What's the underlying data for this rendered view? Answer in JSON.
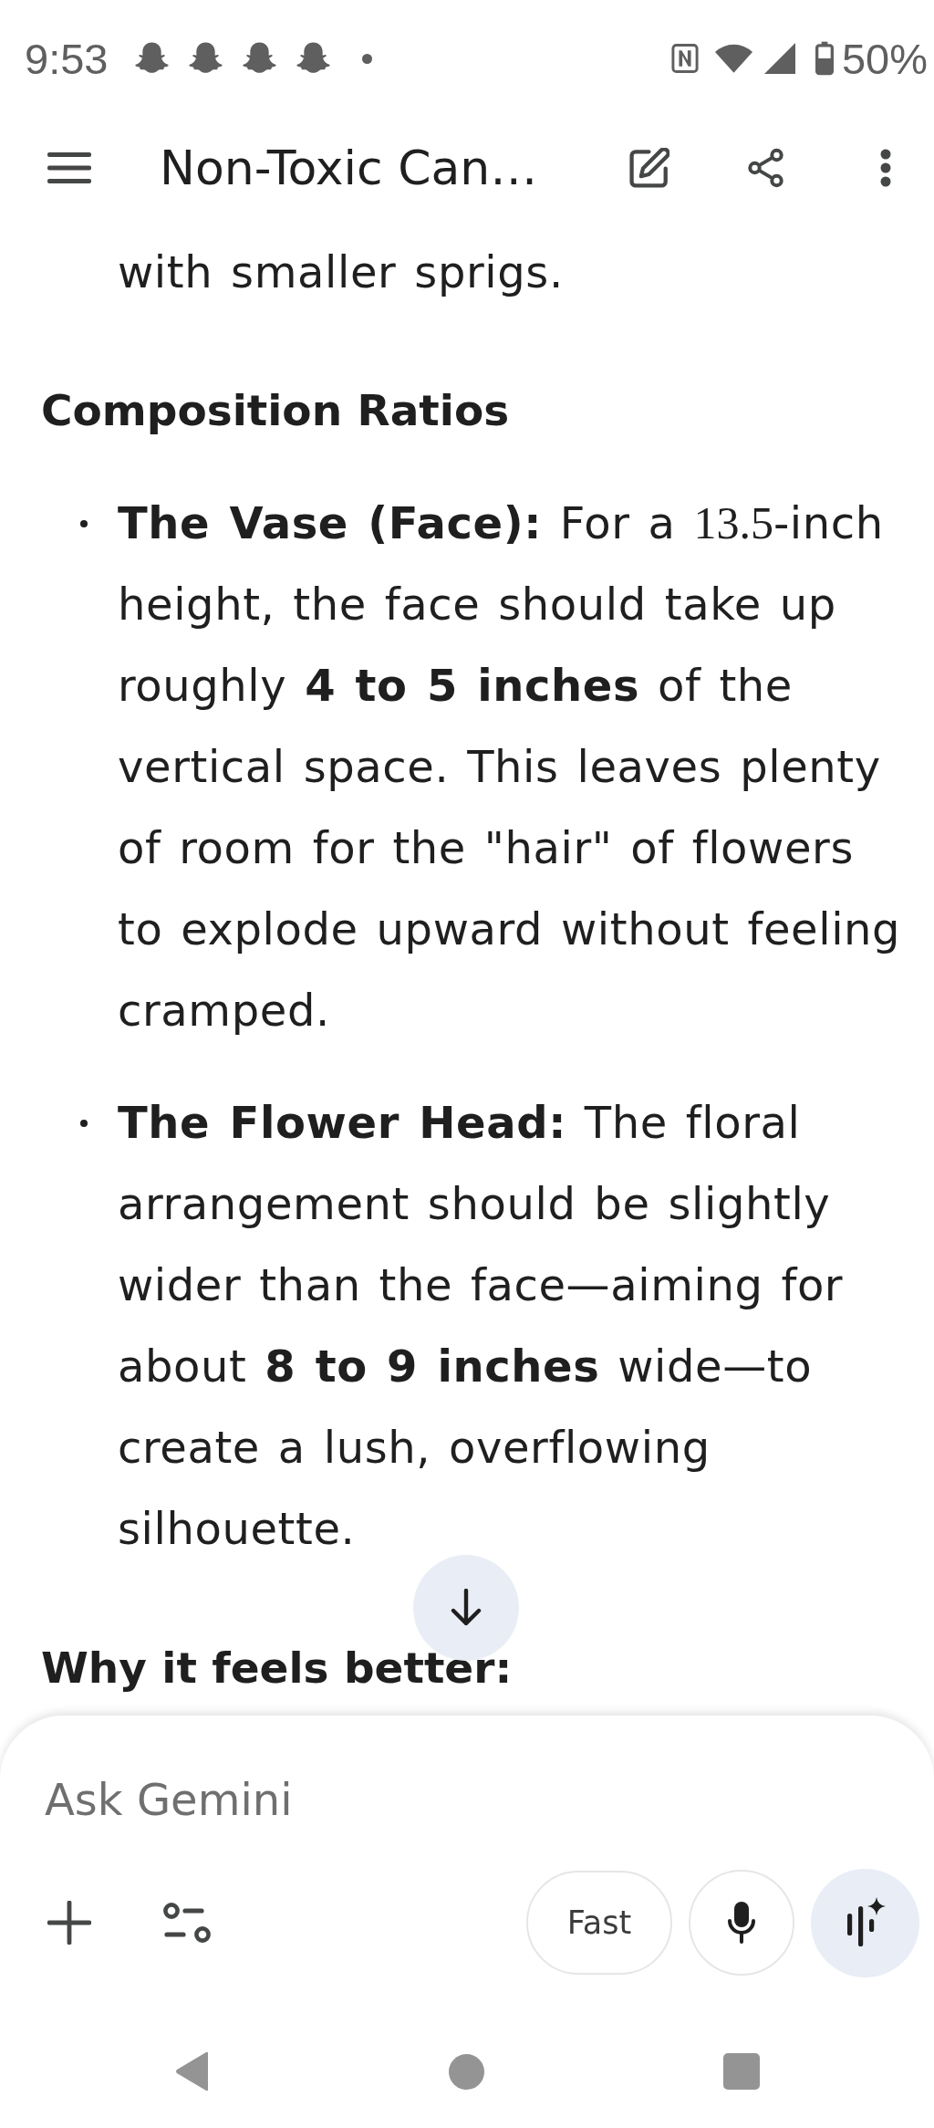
{
  "status_bar": {
    "time": "9:53",
    "battery": "50%"
  },
  "app_bar": {
    "title": "Non-Toxic Can…"
  },
  "content": {
    "lead": "with smaller sprigs.",
    "sections": [
      {
        "heading": "Composition Ratios",
        "bullets": [
          {
            "runs": [
              {
                "kind": "bold",
                "text": "The Vase (Face):"
              },
              {
                "kind": "plain",
                "text": " For a "
              },
              {
                "kind": "math",
                "text": "13.5"
              },
              {
                "kind": "plain",
                "text": "-inch height, the face should take up roughly "
              },
              {
                "kind": "bold",
                "text": "4 to 5 inches"
              },
              {
                "kind": "plain",
                "text": " of the vertical space. This leaves plenty of room for the \"hair\" of flowers to explode upward without feeling cramped."
              }
            ]
          },
          {
            "runs": [
              {
                "kind": "bold",
                "text": "The Flower Head:"
              },
              {
                "kind": "plain",
                "text": " The floral arrangement should be slightly wider than the face—aiming for about "
              },
              {
                "kind": "bold",
                "text": "8 to 9 inches"
              },
              {
                "kind": "plain",
                "text": " wide—to create a lush, overflowing silhouette."
              }
            ]
          }
        ]
      },
      {
        "heading": "Why it feels better:"
      }
    ]
  },
  "composer": {
    "placeholder": "Ask Gemini",
    "mode_button": "Fast"
  }
}
